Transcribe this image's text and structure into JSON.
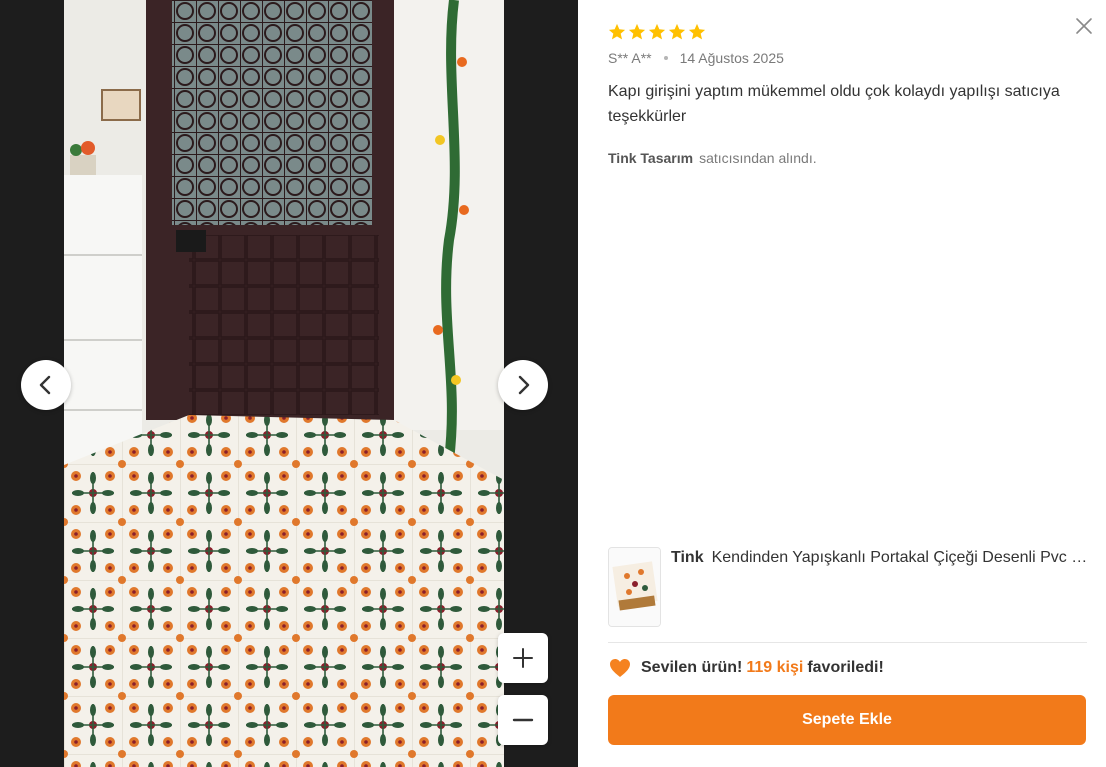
{
  "review": {
    "rating": 5,
    "max_rating": 5,
    "author": "S** A**",
    "date": "14 Ağustos 2025",
    "comment": "Kapı girişini yaptım mükemmel oldu çok kolaydı yapılışı satıcıya teşekkürler",
    "seller_name": "Tink Tasarım",
    "seller_suffix": "satıcısından alındı."
  },
  "product": {
    "brand": "Tink",
    "name": "Kendinden Yapışkanlı Portakal Çiçeği Desenli Pvc Karo Folyo"
  },
  "favorites": {
    "prefix": "Sevilen ürün!",
    "count_label": "119 kişi",
    "suffix": "favoriledi!"
  },
  "cart_button": {
    "label": "Sepete Ekle"
  },
  "icons": {
    "close": "close-icon",
    "prev": "chevron-left-icon",
    "next": "chevron-right-icon",
    "zoom_in": "plus-icon",
    "zoom_out": "minus-icon",
    "heart": "heart-icon",
    "star": "star-icon"
  },
  "colors": {
    "accent": "#f27a1a",
    "star": "#ffc000",
    "gallery_bg": "#1d1d1d"
  }
}
